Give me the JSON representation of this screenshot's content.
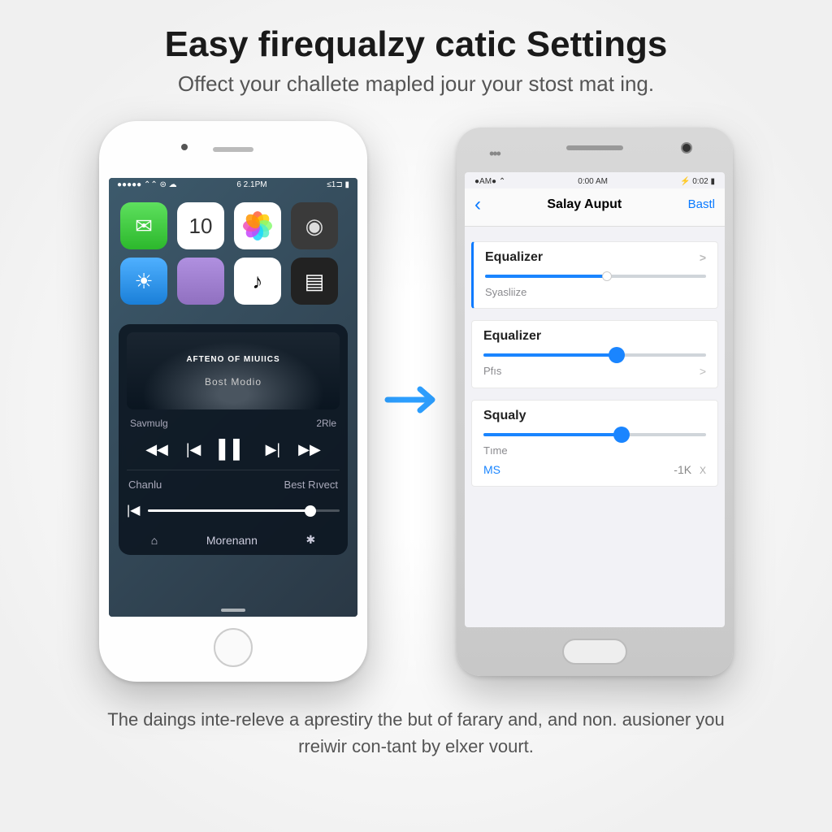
{
  "headline": "Easy firequalzy catic Settings",
  "subhead": "Offect your challete mapled jour your stost mat ing.",
  "footer": "The daings inte-releve a aprestiry the but of farary and, and non. ausioner you rreiwir con-tant by elxer vourt.",
  "phone1": {
    "status": {
      "left": "●●●●● ⌃⌃ ⊜ ☁",
      "center": "6 2.1PM",
      "right": "≤1⊐ ▮"
    },
    "apps": {
      "cal_num": "10",
      "msg_icon": "✉",
      "cam_icon": "◉",
      "weather_icon": "☀",
      "music_icon": "♪",
      "video_icon": "▤"
    },
    "player": {
      "art_line1": "AFTENO OF MIUIICS",
      "art_line2": "Bost Modio",
      "left_label": "Savmulg",
      "right_label": "2Rle",
      "bottom_left": "Chanlu",
      "bottom_right": "Best Rıvect",
      "footer_center": "Morenann",
      "footer_left_icon": "⌂",
      "footer_right_icon": "✱"
    }
  },
  "phone2": {
    "status": {
      "left": "●AM● ⌃",
      "center": "0:00 AM",
      "right": "⚡ 0:02 ▮"
    },
    "nav": {
      "title": "Salay Auput",
      "action": "Bastl"
    },
    "cards": [
      {
        "title": "Equalizer",
        "sub": "Syasliize",
        "fill_pct": 55,
        "thumb_style": "sm",
        "chev": ">"
      },
      {
        "title": "Equalizer",
        "sub": "Pfıs",
        "fill_pct": 60,
        "thumb_style": "big",
        "chev": ">"
      },
      {
        "title": "Squaly",
        "sub": "Tıme",
        "bl": "MS",
        "br": "-1K",
        "bx": "X",
        "fill_pct": 62,
        "thumb_style": "big"
      }
    ]
  }
}
